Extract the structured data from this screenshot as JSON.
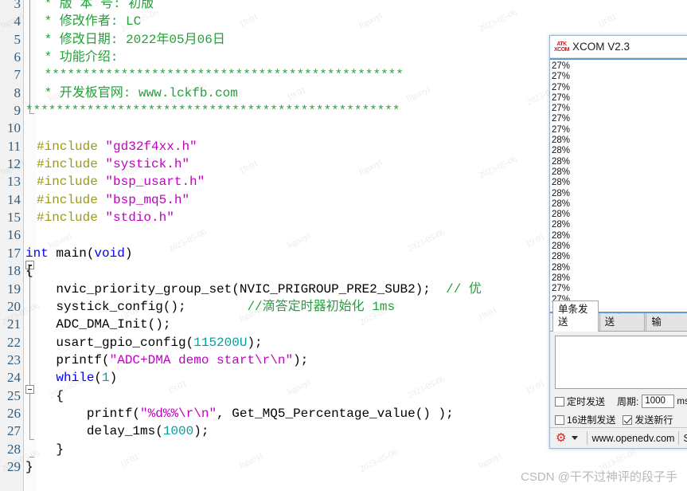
{
  "editor": {
    "first_line_number": 3,
    "lines": [
      {
        "num": 3,
        "indent": true,
        "tokens": [
          {
            "t": " * 版 本 号: 初版",
            "c": "comment"
          }
        ]
      },
      {
        "num": 4,
        "indent": true,
        "tokens": [
          {
            "t": " * 修改作者: LC",
            "c": "comment"
          }
        ]
      },
      {
        "num": 5,
        "indent": true,
        "tokens": [
          {
            "t": " * 修改日期: 2022年05月06日",
            "c": "comment"
          }
        ]
      },
      {
        "num": 6,
        "indent": true,
        "tokens": [
          {
            "t": " * 功能介绍:",
            "c": "comment"
          }
        ]
      },
      {
        "num": 7,
        "indent": true,
        "tokens": [
          {
            "t": " ***********************************************",
            "c": "comment"
          }
        ]
      },
      {
        "num": 8,
        "indent": true,
        "tokens": [
          {
            "t": " * 开发板官网: www.lckfb.com",
            "c": "comment"
          }
        ]
      },
      {
        "num": 9,
        "indent": false,
        "tokens": [
          {
            "t": "*************************************************",
            "c": "comment"
          }
        ]
      },
      {
        "num": 10,
        "indent": false,
        "tokens": [
          {
            "t": "",
            "c": "plain"
          }
        ]
      },
      {
        "num": 11,
        "indent": true,
        "tokens": [
          {
            "t": "#include ",
            "c": "pp"
          },
          {
            "t": "\"gd32f4xx.h\"",
            "c": "str"
          }
        ]
      },
      {
        "num": 12,
        "indent": true,
        "tokens": [
          {
            "t": "#include ",
            "c": "pp"
          },
          {
            "t": "\"systick.h\"",
            "c": "str"
          }
        ]
      },
      {
        "num": 13,
        "indent": true,
        "tokens": [
          {
            "t": "#include ",
            "c": "pp"
          },
          {
            "t": "\"bsp_usart.h\"",
            "c": "str"
          }
        ]
      },
      {
        "num": 14,
        "indent": true,
        "tokens": [
          {
            "t": "#include ",
            "c": "pp"
          },
          {
            "t": "\"bsp_mq5.h\"",
            "c": "str"
          }
        ]
      },
      {
        "num": 15,
        "indent": true,
        "tokens": [
          {
            "t": "#include ",
            "c": "pp"
          },
          {
            "t": "\"stdio.h\"",
            "c": "str"
          }
        ]
      },
      {
        "num": 16,
        "indent": false,
        "tokens": [
          {
            "t": "",
            "c": "plain"
          }
        ]
      },
      {
        "num": 17,
        "indent": false,
        "tokens": [
          {
            "t": "int ",
            "c": "kw"
          },
          {
            "t": "main(",
            "c": "plain"
          },
          {
            "t": "void",
            "c": "kw"
          },
          {
            "t": ")",
            "c": "plain"
          }
        ]
      },
      {
        "num": 18,
        "indent": false,
        "tokens": [
          {
            "t": "{",
            "c": "plain"
          }
        ]
      },
      {
        "num": 19,
        "indent": false,
        "tokens": [
          {
            "t": "    nvic_priority_group_set(NVIC_PRIGROUP_PRE2_SUB2);  ",
            "c": "plain"
          },
          {
            "t": "// 优",
            "c": "comment"
          }
        ]
      },
      {
        "num": 20,
        "indent": false,
        "tokens": [
          {
            "t": "    systick_config();        ",
            "c": "plain"
          },
          {
            "t": "//滴答定时器初始化 1ms",
            "c": "comment"
          }
        ]
      },
      {
        "num": 21,
        "indent": false,
        "tokens": [
          {
            "t": "    ADC_DMA_Init();",
            "c": "plain"
          }
        ]
      },
      {
        "num": 22,
        "indent": false,
        "tokens": [
          {
            "t": "    usart_gpio_config(",
            "c": "plain"
          },
          {
            "t": "115200U",
            "c": "num"
          },
          {
            "t": ");",
            "c": "plain"
          }
        ]
      },
      {
        "num": 23,
        "indent": false,
        "tokens": [
          {
            "t": "    printf(",
            "c": "plain"
          },
          {
            "t": "\"ADC+DMA demo start\\r\\n\"",
            "c": "str"
          },
          {
            "t": ");",
            "c": "plain"
          }
        ]
      },
      {
        "num": 24,
        "indent": false,
        "tokens": [
          {
            "t": "    ",
            "c": "plain"
          },
          {
            "t": "while",
            "c": "kw"
          },
          {
            "t": "(",
            "c": "plain"
          },
          {
            "t": "1",
            "c": "num"
          },
          {
            "t": ")",
            "c": "plain"
          }
        ]
      },
      {
        "num": 25,
        "indent": false,
        "tokens": [
          {
            "t": "    {",
            "c": "plain"
          }
        ]
      },
      {
        "num": 26,
        "indent": false,
        "tokens": [
          {
            "t": "        printf(",
            "c": "plain"
          },
          {
            "t": "\"%d%%\\r\\n\"",
            "c": "str"
          },
          {
            "t": ", Get_MQ5_Percentage_value() );",
            "c": "plain"
          }
        ]
      },
      {
        "num": 27,
        "indent": false,
        "tokens": [
          {
            "t": "        delay_1ms(",
            "c": "plain"
          },
          {
            "t": "1000",
            "c": "num"
          },
          {
            "t": ");",
            "c": "plain"
          }
        ]
      },
      {
        "num": 28,
        "indent": false,
        "tokens": [
          {
            "t": "    }",
            "c": "plain"
          }
        ]
      },
      {
        "num": 29,
        "indent": false,
        "tokens": [
          {
            "t": "}",
            "c": "plain"
          }
        ]
      }
    ]
  },
  "xcom": {
    "title": "XCOM V2.3",
    "logo_line1": "ATK",
    "logo_line2": "XCOM",
    "receive_lines": [
      "27%",
      "27%",
      "27%",
      "27%",
      "27%",
      "27%",
      "27%",
      "28%",
      "28%",
      "28%",
      "28%",
      "28%",
      "28%",
      "28%",
      "28%",
      "28%",
      "28%",
      "28%",
      "28%",
      "28%",
      "28%",
      "27%",
      "27%",
      "27%"
    ],
    "tabs": [
      {
        "label": "单条发送",
        "active": true
      },
      {
        "label": "多条发送",
        "active": false
      },
      {
        "label": "协议传输",
        "active": false
      }
    ],
    "send_input_value": "",
    "options": {
      "timed_send_label": "定时发送",
      "timed_send_checked": false,
      "period_label": "周期:",
      "period_value": "1000",
      "period_unit": "ms",
      "hex_send_label": "16进制发送",
      "hex_send_checked": false,
      "newline_label": "发送新行",
      "newline_checked": true
    },
    "statusbar": {
      "gear_icon": "gear-icon",
      "site": "www.openedv.com",
      "trailing": "S"
    }
  },
  "watermarks": {
    "csdn": "CSDN @干不过神评的段子手",
    "tiled": [
      "liguoyi",
      "2023-05-06",
      "19:01",
      "liguoyi",
      "2023-05-06",
      "19:01",
      "liguoyi",
      "2023-05-06",
      "19:01",
      "liguoyi",
      "2023-05-06",
      "19:01",
      "liguoyi",
      "2023-05-06",
      "19:01",
      "liguoyi",
      "2023-05-06",
      "19:01",
      "liguoyi",
      "2023-05-06"
    ]
  },
  "colors": {
    "comment_green": "#23a03a",
    "string_magenta": "#c000c0",
    "keyword_blue": "#0000ff",
    "number_teal": "#00a0a0",
    "preproc_olive": "#9a9a16",
    "xcom_border_blue": "#5b9bd5",
    "gear_red": "#e02020"
  }
}
